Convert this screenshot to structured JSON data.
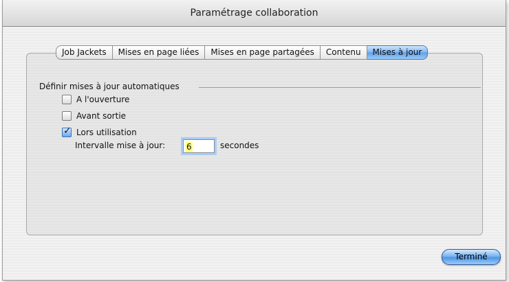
{
  "window": {
    "title": "Paramétrage collaboration"
  },
  "tabs": [
    {
      "label": "Job Jackets",
      "selected": false
    },
    {
      "label": "Mises en page liées",
      "selected": false
    },
    {
      "label": "Mises en page partagées",
      "selected": false
    },
    {
      "label": "Contenu",
      "selected": false
    },
    {
      "label": "Mises à jour",
      "selected": true
    }
  ],
  "group": {
    "label": "Définir mises à jour automatiques",
    "options": [
      {
        "label": "A l'ouverture",
        "checked": false
      },
      {
        "label": "Avant sortie",
        "checked": false
      },
      {
        "label": "Lors utilisation",
        "checked": true
      }
    ],
    "interval": {
      "label": "Intervalle mise à jour:",
      "value": "6",
      "unit": "secondes"
    }
  },
  "footer": {
    "done_label": "Terminé"
  },
  "colors": {
    "accent": "#5e9de6",
    "checkbox_checked": "#6aa8ee"
  }
}
